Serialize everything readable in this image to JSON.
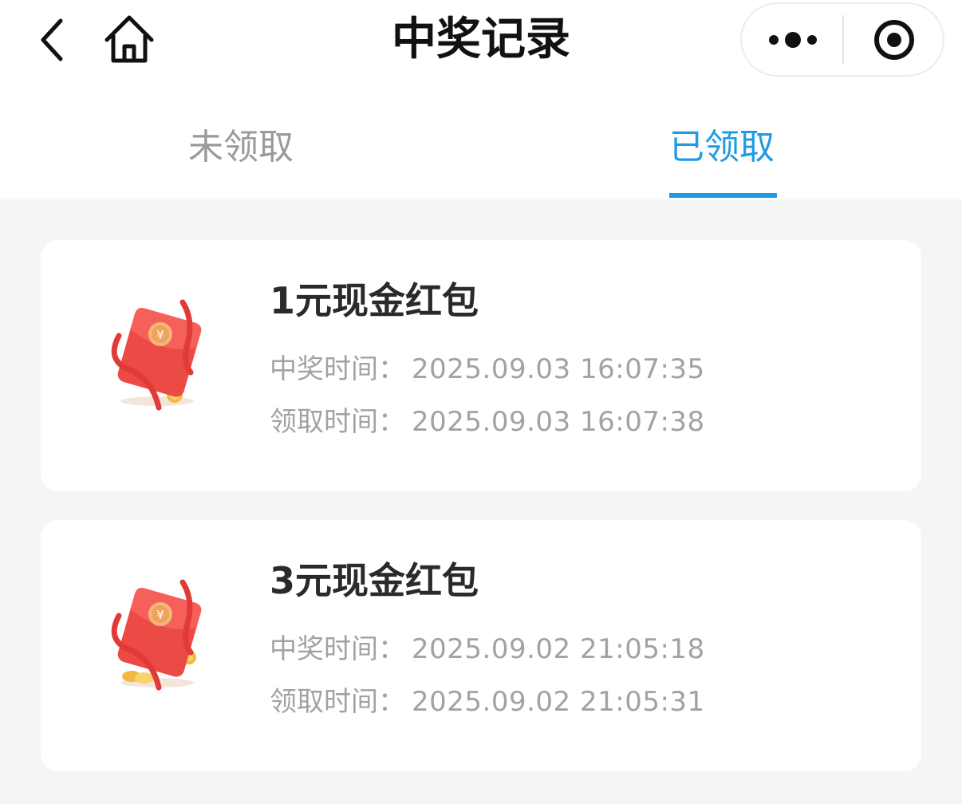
{
  "header": {
    "title": "中奖记录",
    "back_icon": "chevron-left-icon",
    "home_icon": "home-icon",
    "more_icon": "more-dots-icon",
    "close_icon": "target-close-icon"
  },
  "tabs": [
    {
      "label": "未领取",
      "active": false
    },
    {
      "label": "已领取",
      "active": true,
      "accent_color": "#1f9be3"
    }
  ],
  "records": [
    {
      "title": "1元现金红包",
      "icon": "red-envelope-icon",
      "win_time_label": "中奖时间：",
      "win_time": "2025.09.03 16:07:35",
      "claim_time_label": "领取时间：",
      "claim_time": "2025.09.03 16:07:38"
    },
    {
      "title": "3元现金红包",
      "icon": "red-envelope-icon",
      "win_time_label": "中奖时间：",
      "win_time": "2025.09.02 21:05:18",
      "claim_time_label": "领取时间：",
      "claim_time": "2025.09.02 21:05:31"
    }
  ],
  "colors": {
    "accent": "#1f9be3",
    "background": "#f5f5f5",
    "card": "#ffffff",
    "envelope_red": "#ec4a45"
  }
}
